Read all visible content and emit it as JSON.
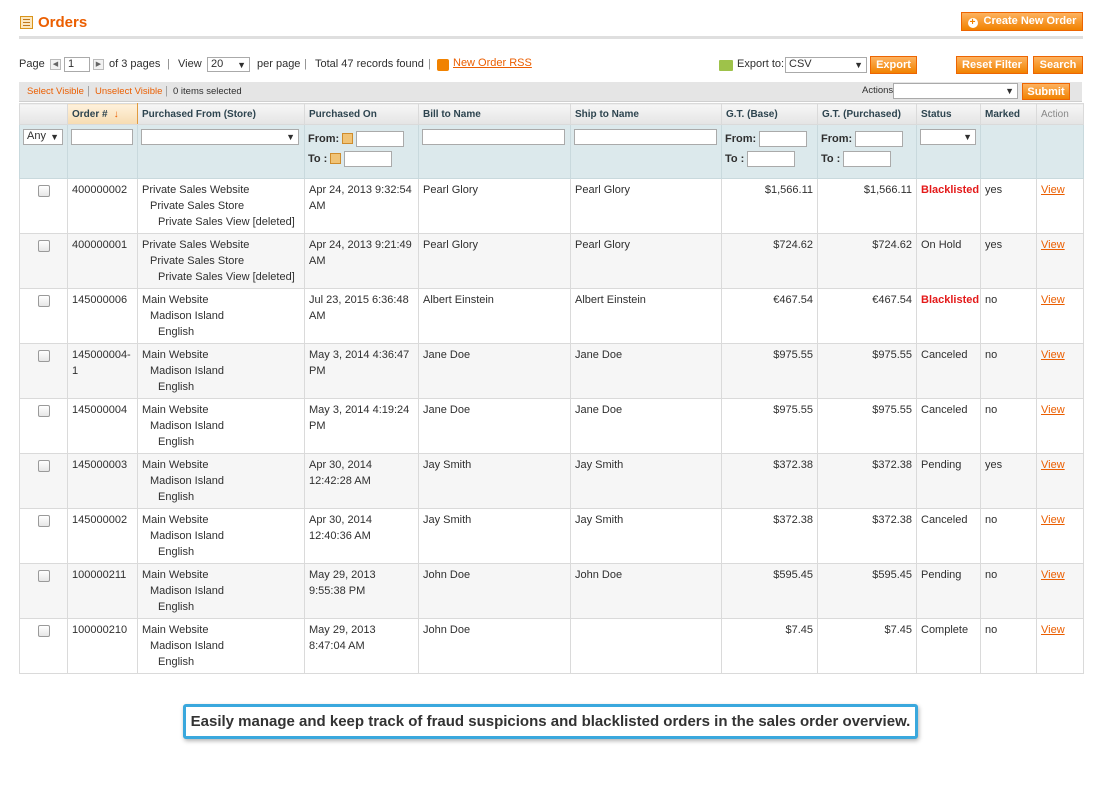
{
  "header": {
    "title": "Orders",
    "create_button": "Create New Order"
  },
  "pager": {
    "page_label": "Page",
    "page_value": "1",
    "of_pages": "of 3 pages",
    "view_label": "View",
    "per_page_value": "20",
    "per_page_label": "per page",
    "total_records": "Total 47 records found",
    "rss_link": "New Order RSS",
    "export_label": "Export to:",
    "export_format": "CSV",
    "export_button": "Export",
    "reset_filter_button": "Reset Filter",
    "search_button": "Search"
  },
  "massaction": {
    "select_visible": "Select Visible",
    "unselect_visible": "Unselect Visible",
    "items_selected": "0 items selected",
    "actions_label": "Actions",
    "submit_button": "Submit"
  },
  "columns": [
    "Order #",
    "Purchased From (Store)",
    "Purchased On",
    "Bill to Name",
    "Ship to Name",
    "G.T. (Base)",
    "G.T. (Purchased)",
    "Status",
    "Marked",
    "Action"
  ],
  "filters": {
    "any_value": "Any",
    "from_label": "From:",
    "to_label": "To :"
  },
  "rows": [
    {
      "order": "400000002",
      "store1": "Private Sales Website",
      "store2": "Private Sales Store",
      "store3": "Private Sales View [deleted]",
      "purchased_on": "Apr 24, 2013 9:32:54 AM",
      "bill_to": "Pearl Glory",
      "ship_to": "Pearl Glory",
      "gt_base": "$1,566.11",
      "gt_purchased": "$1,566.11",
      "status": "Blacklisted",
      "marked": "yes",
      "action": "View"
    },
    {
      "order": "400000001",
      "store1": "Private Sales Website",
      "store2": "Private Sales Store",
      "store3": "Private Sales View [deleted]",
      "purchased_on": "Apr 24, 2013 9:21:49 AM",
      "bill_to": "Pearl Glory",
      "ship_to": "Pearl Glory",
      "gt_base": "$724.62",
      "gt_purchased": "$724.62",
      "status": "On Hold",
      "marked": "yes",
      "action": "View"
    },
    {
      "order": "145000006",
      "store1": "Main Website",
      "store2": "Madison Island",
      "store3": "English",
      "purchased_on": "Jul 23, 2015 6:36:48 AM",
      "bill_to": "Albert Einstein",
      "ship_to": "Albert Einstein",
      "gt_base": "€467.54",
      "gt_purchased": "€467.54",
      "status": "Blacklisted",
      "marked": "no",
      "action": "View"
    },
    {
      "order": "145000004-1",
      "store1": "Main Website",
      "store2": "Madison Island",
      "store3": "English",
      "purchased_on": "May 3, 2014 4:36:47 PM",
      "bill_to": "Jane Doe",
      "ship_to": "Jane Doe",
      "gt_base": "$975.55",
      "gt_purchased": "$975.55",
      "status": "Canceled",
      "marked": "no",
      "action": "View"
    },
    {
      "order": "145000004",
      "store1": "Main Website",
      "store2": "Madison Island",
      "store3": "English",
      "purchased_on": "May 3, 2014 4:19:24 PM",
      "bill_to": "Jane Doe",
      "ship_to": "Jane Doe",
      "gt_base": "$975.55",
      "gt_purchased": "$975.55",
      "status": "Canceled",
      "marked": "no",
      "action": "View"
    },
    {
      "order": "145000003",
      "store1": "Main Website",
      "store2": "Madison Island",
      "store3": "English",
      "purchased_on": "Apr 30, 2014 12:42:28 AM",
      "bill_to": "Jay Smith",
      "ship_to": "Jay Smith",
      "gt_base": "$372.38",
      "gt_purchased": "$372.38",
      "status": "Pending",
      "marked": "yes",
      "action": "View"
    },
    {
      "order": "145000002",
      "store1": "Main Website",
      "store2": "Madison Island",
      "store3": "English",
      "purchased_on": "Apr 30, 2014 12:40:36 AM",
      "bill_to": "Jay Smith",
      "ship_to": "Jay Smith",
      "gt_base": "$372.38",
      "gt_purchased": "$372.38",
      "status": "Canceled",
      "marked": "no",
      "action": "View"
    },
    {
      "order": "100000211",
      "store1": "Main Website",
      "store2": "Madison Island",
      "store3": "English",
      "purchased_on": "May 29, 2013 9:55:38 PM",
      "bill_to": "John Doe",
      "ship_to": "John Doe",
      "gt_base": "$595.45",
      "gt_purchased": "$595.45",
      "status": "Pending",
      "marked": "no",
      "action": "View"
    },
    {
      "order": "100000210",
      "store1": "Main Website",
      "store2": "Madison Island",
      "store3": "English",
      "purchased_on": "May 29, 2013 8:47:04 AM",
      "bill_to": "John Doe",
      "ship_to": "",
      "gt_base": "$7.45",
      "gt_purchased": "$7.45",
      "status": "Complete",
      "marked": "no",
      "action": "View"
    }
  ],
  "caption": "Easily manage and keep track of fraud suspicions and blacklisted orders in the sales order overview.",
  "colors": {
    "accent": "#eb5e00",
    "blacklisted": "#e41a1a",
    "caption_border": "#3aa8dd"
  }
}
